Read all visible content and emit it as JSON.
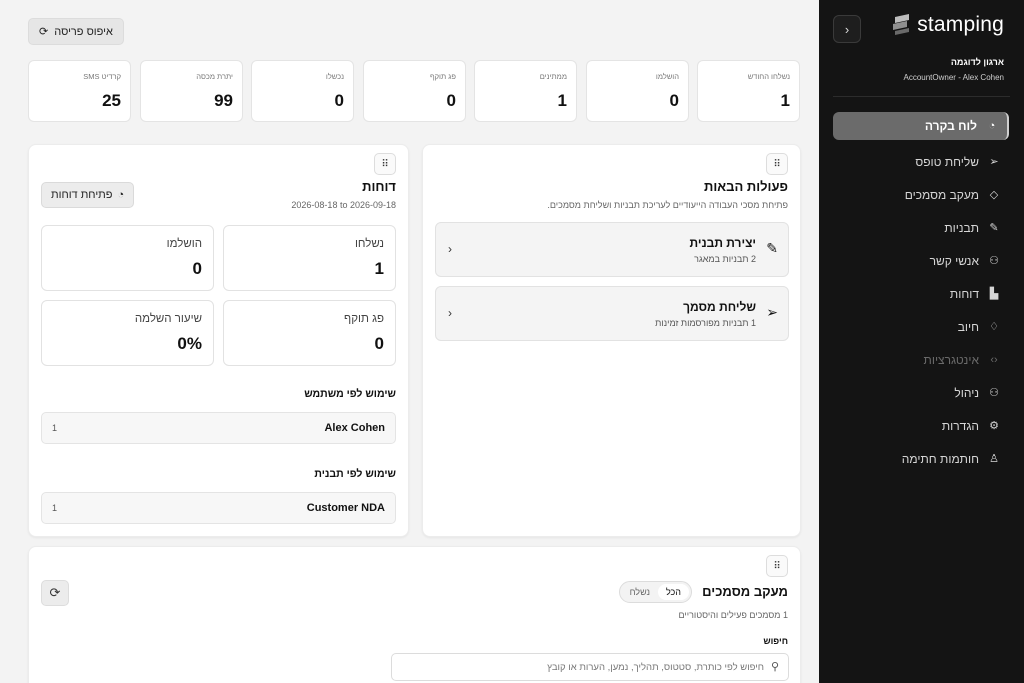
{
  "sidebar": {
    "brand": "stamping",
    "org_name": "ארגון לדוגמה",
    "org_sub": "AccountOwner - Alex Cohen",
    "items": [
      {
        "label": "לוח בקרה",
        "icon": "◔"
      },
      {
        "label": "שליחת טופס",
        "icon": "➢"
      },
      {
        "label": "מעקב מסמכים",
        "icon": "◇"
      },
      {
        "label": "תבניות",
        "icon": "✎"
      },
      {
        "label": "אנשי קשר",
        "icon": "⚇"
      },
      {
        "label": "דוחות",
        "icon": "▙"
      },
      {
        "label": "חיוב",
        "icon": "♢"
      },
      {
        "label": "אינטגרציות",
        "icon": "‹›"
      },
      {
        "label": "ניהול",
        "icon": "⚇"
      },
      {
        "label": "הגדרות",
        "icon": "⚙"
      },
      {
        "label": "חותמות חתימה",
        "icon": "♙"
      }
    ]
  },
  "top": {
    "reset_label": "איפוס פריסה"
  },
  "stats": [
    {
      "label": "נשלחו החודש",
      "value": "1"
    },
    {
      "label": "הושלמו",
      "value": "0"
    },
    {
      "label": "ממתינים",
      "value": "1"
    },
    {
      "label": "פג תוקף",
      "value": "0"
    },
    {
      "label": "נכשלו",
      "value": "0"
    },
    {
      "label": "יתרת מכסה",
      "value": "99"
    },
    {
      "label": "קרדיט SMS",
      "value": "25"
    }
  ],
  "next_actions": {
    "title": "פעולות הבאות",
    "subtitle": "פתיחת מסכי העבודה הייעודיים לעריכת תבניות ושליחת מסמכים.",
    "items": [
      {
        "title": "יצירת תבנית",
        "sub": "2 תבניות במאגר",
        "icon": "✎"
      },
      {
        "title": "שליחת מסמך",
        "sub": "1 תבניות מפורסמות זמינות",
        "icon": "➢"
      }
    ]
  },
  "reports": {
    "title": "דוחות",
    "date_range": "2026-08-18 to 2026-09-18",
    "open_label": "פתיחת דוחות",
    "metrics": [
      {
        "label": "נשלחו",
        "value": "1"
      },
      {
        "label": "הושלמו",
        "value": "0"
      },
      {
        "label": "פג תוקף",
        "value": "0"
      },
      {
        "label": "שיעור השלמה",
        "value": "0%"
      }
    ],
    "by_user_title": "שימוש לפי משתמש",
    "by_user": {
      "name": "Alex Cohen",
      "count": "1"
    },
    "by_template_title": "שימוש לפי תבנית",
    "by_template": {
      "name": "Customer NDA",
      "count": "1"
    }
  },
  "tracking": {
    "title": "מעקב מסמכים",
    "subtitle": "1 מסמכים פעילים והיסטוריים",
    "filter_all": "הכל",
    "filter_sent": "נשלח",
    "search_label": "חיפוש",
    "search_placeholder": "חיפוש לפי כותרת, סטטוס, תהליך, נמען, הערות או קובץ"
  },
  "colors": {
    "sidebar_bg": "#141414",
    "active_item": "#6b6b6b",
    "page_bg": "#f3f3f3"
  }
}
